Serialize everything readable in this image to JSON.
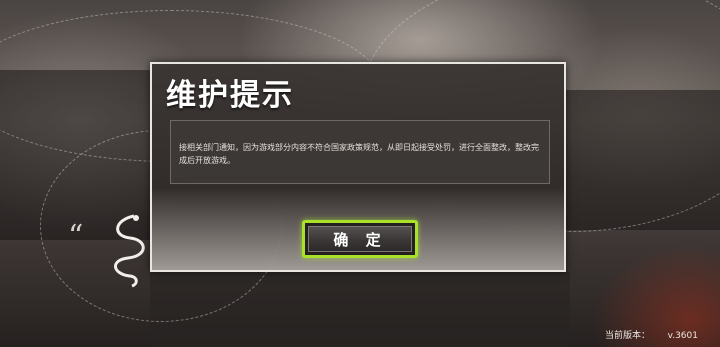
{
  "dialog": {
    "title": "维护提示",
    "message": "接相关部门通知，因为游戏部分内容不符合国家政策规范，从即日起接受处罚，进行全面整改，整改完成后开放游戏。",
    "confirm_label": "确 定",
    "confirm_border_color": "#a9e02a"
  },
  "footer": {
    "version_label": "当前版本：",
    "version_value": "v.3601"
  },
  "background": {
    "quote_mark": "“",
    "logo_icon": "serpent-logo-icon"
  }
}
